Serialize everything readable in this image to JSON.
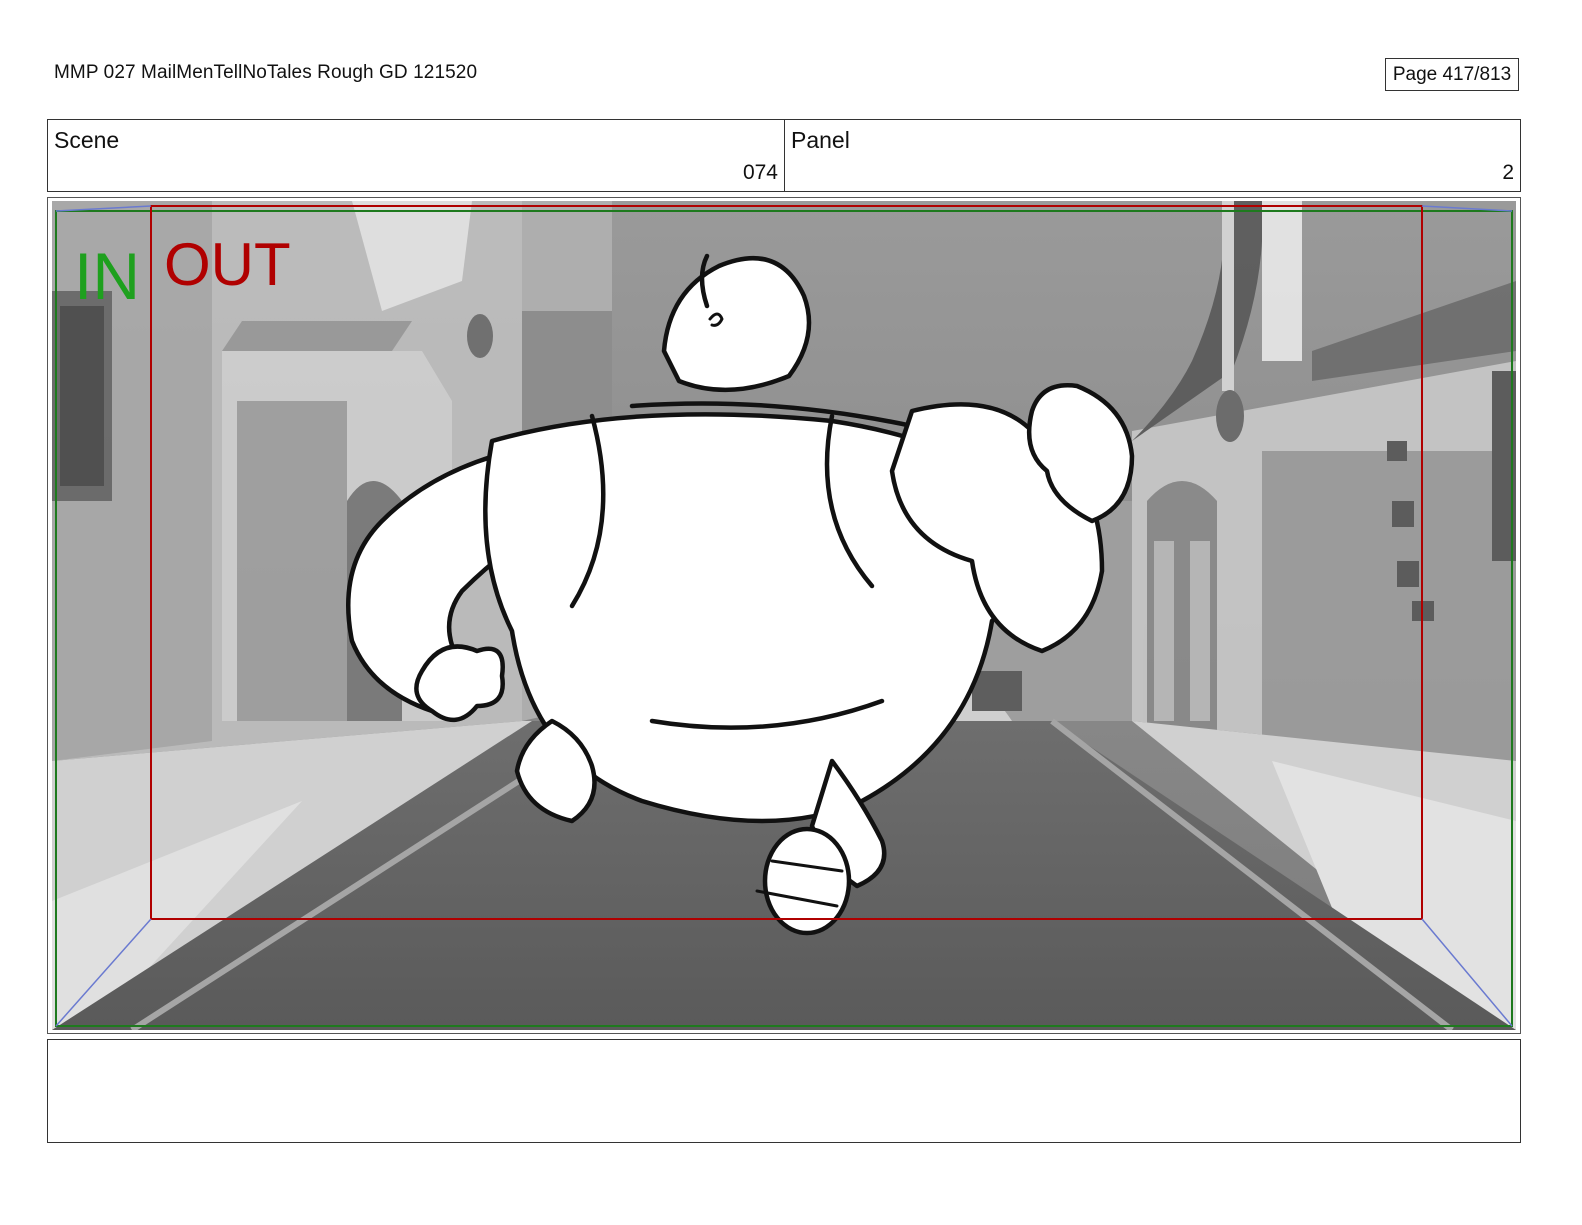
{
  "header": {
    "doc_title": "MMP 027 MailMenTellNoTales Rough GD 121520",
    "page_label": "Page 417/813"
  },
  "info": {
    "scene_label": "Scene",
    "scene_value": "074",
    "panel_label": "Panel",
    "panel_value": "2"
  },
  "frame": {
    "in_label": "IN",
    "out_label": "OUT",
    "in_color": "#1ea01e",
    "out_color": "#b00000"
  },
  "notes": {
    "text": ""
  }
}
